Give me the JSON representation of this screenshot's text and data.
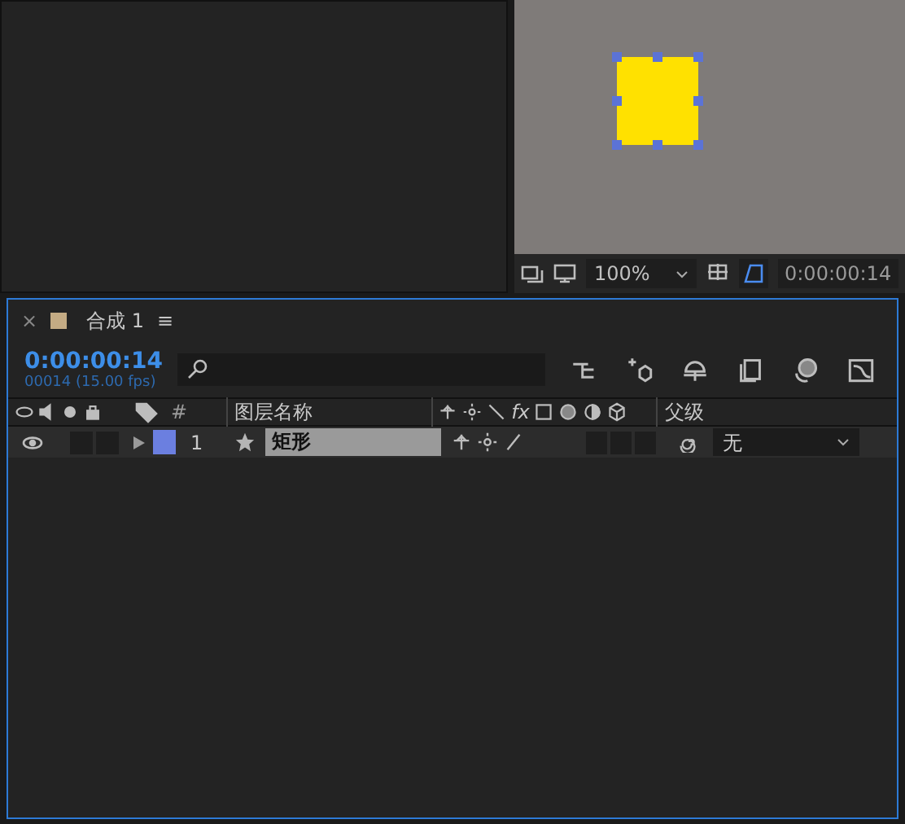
{
  "viewer": {
    "zoom": "100%",
    "timecode": "0:00:00:14"
  },
  "timeline": {
    "tab": {
      "close": "×",
      "title": "合成 1",
      "menu": "≡"
    },
    "timecode": "0:00:00:14",
    "frame_info": "00014 (15.00 fps)",
    "columns": {
      "number": "#",
      "layer_name": "图层名称",
      "fx": "fx",
      "parent": "父级"
    },
    "layers": [
      {
        "number": "1",
        "name": "矩形",
        "color": "#6b7fe0",
        "selected": true,
        "parent": "无"
      }
    ]
  }
}
